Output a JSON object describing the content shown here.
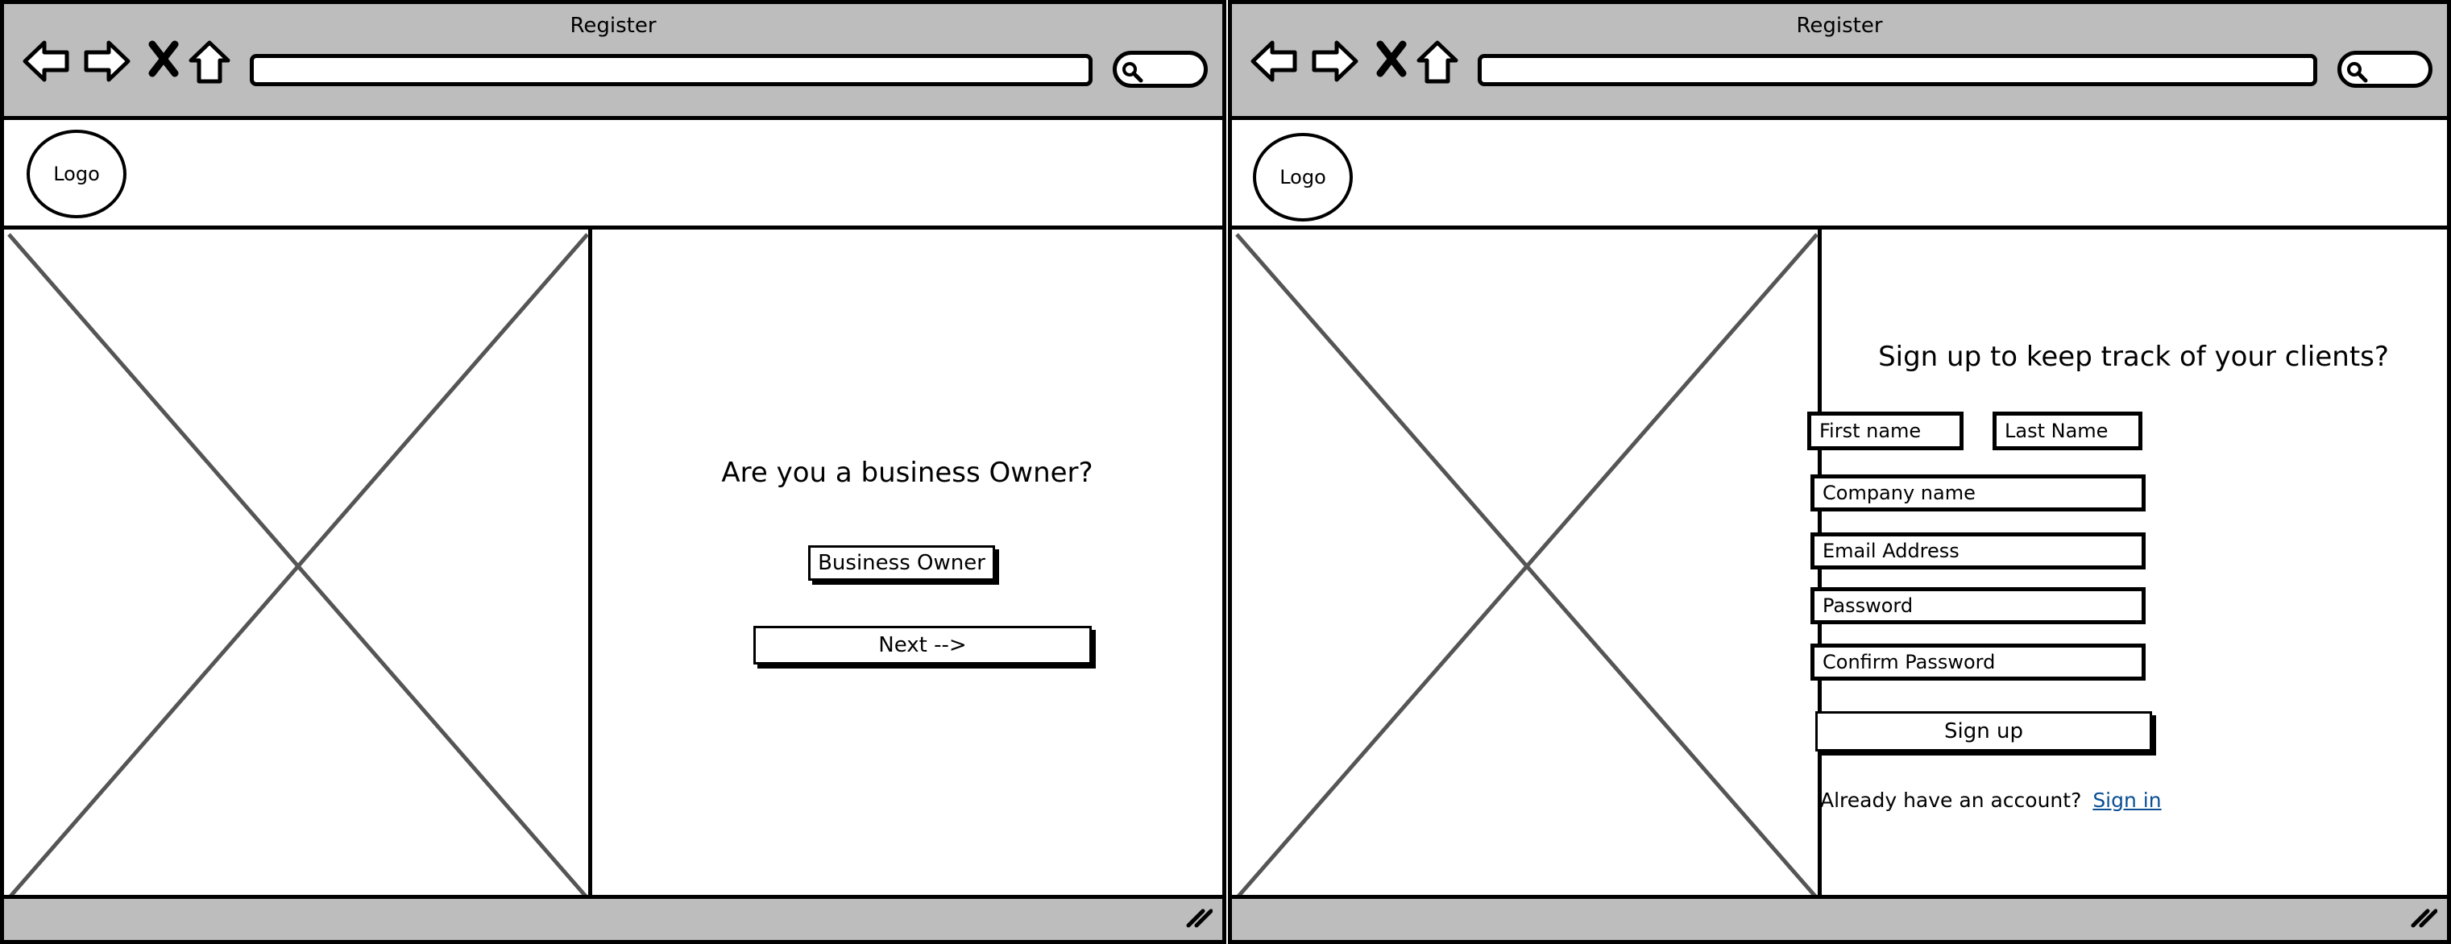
{
  "windows": [
    {
      "title": "Register",
      "logo_label": "Logo",
      "heading": "Are you a business Owner?",
      "buttons": {
        "business_owner": "Business Owner",
        "next": "Next -->"
      }
    },
    {
      "title": "Register",
      "logo_label": "Logo",
      "heading": "Sign up to  keep track of your clients?",
      "fields": {
        "first_name": "First name",
        "last_name": "Last Name",
        "company_name": "Company name",
        "email_address": "Email Address",
        "password": "Password",
        "confirm_password": "Confirm Password"
      },
      "signup_label": "Sign up",
      "signin_prompt": "Already have an account?",
      "signin_link": "Sign in"
    }
  ],
  "icons": {
    "back": "arrow-left-icon",
    "forward": "arrow-right-icon",
    "close": "close-icon",
    "home": "home-icon",
    "search": "search-icon",
    "resize": "resize-grip-icon"
  },
  "colors": {
    "chrome": "#bdbdbd",
    "link": "#0a4f94",
    "border": "#000000",
    "placeholder_cross": "#555555"
  }
}
